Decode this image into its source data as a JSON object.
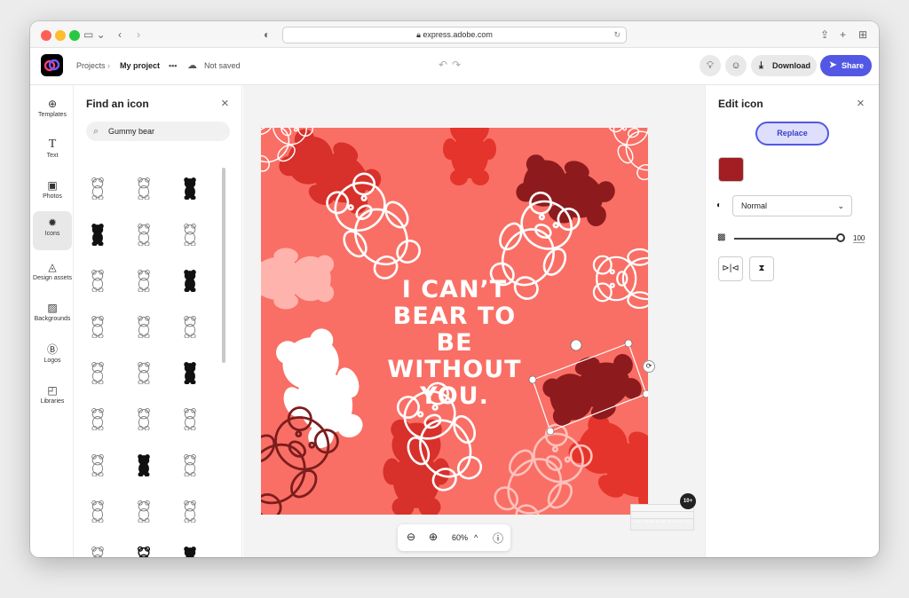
{
  "browser": {
    "url": "express.adobe.com",
    "traffic_colors": [
      "#fe5f57",
      "#febc2e",
      "#28c840"
    ],
    "lock_icon": "lock-icon",
    "share_icon": "share-icon",
    "newtab_icon": "plus-icon",
    "tabs_icon": "grid-icon"
  },
  "appbar": {
    "crumb_projects": "Projects",
    "crumb_separator": "›",
    "crumb_current": "My project",
    "more": "•••",
    "save_status": "Not saved",
    "undo": "↶",
    "redo": "↷",
    "download_label": "Download",
    "share_label": "Share",
    "accent_color": "#5258e4"
  },
  "rail": {
    "items": [
      {
        "label": "Templates",
        "icon": "templates-icon",
        "glyph": "⊕"
      },
      {
        "label": "Text",
        "icon": "text-icon",
        "glyph": "T"
      },
      {
        "label": "Photos",
        "icon": "photos-icon",
        "glyph": "▣"
      },
      {
        "label": "Icons",
        "icon": "icons-icon",
        "glyph": "✹"
      },
      {
        "label": "Design assets",
        "icon": "design-assets-icon",
        "glyph": "◬"
      },
      {
        "label": "Backgrounds",
        "icon": "backgrounds-icon",
        "glyph": "▨"
      },
      {
        "label": "Logos",
        "icon": "logos-icon",
        "glyph": "Ⓑ"
      },
      {
        "label": "Libraries",
        "icon": "libraries-icon",
        "glyph": "◰"
      }
    ]
  },
  "left_panel": {
    "title": "Find an icon",
    "close": "×",
    "search_value": "Gummy bear",
    "search_icon": "search-icon"
  },
  "artboard": {
    "background": "#f96f65",
    "headline": [
      "I CAN’T",
      "BEAR TO",
      "BE WITHOUT",
      "YOU."
    ]
  },
  "zoom": {
    "zoom_out": "⊖",
    "zoom_in": "⊕",
    "level": "60%",
    "caret": "^",
    "info": "ⓘ"
  },
  "pages_badge": "10+",
  "thumbnail_text": "I CAN’T BEAR TO BE WITHOUT YOU.",
  "right_panel": {
    "title": "Edit icon",
    "close": "×",
    "replace_label": "Replace",
    "swatch_color": "#a21e22",
    "blend_mode": "Normal",
    "opacity": 100,
    "opacity_label": "100",
    "flip_h_icon": "flip-horizontal-icon",
    "flip_v_icon": "flip-vertical-icon"
  }
}
